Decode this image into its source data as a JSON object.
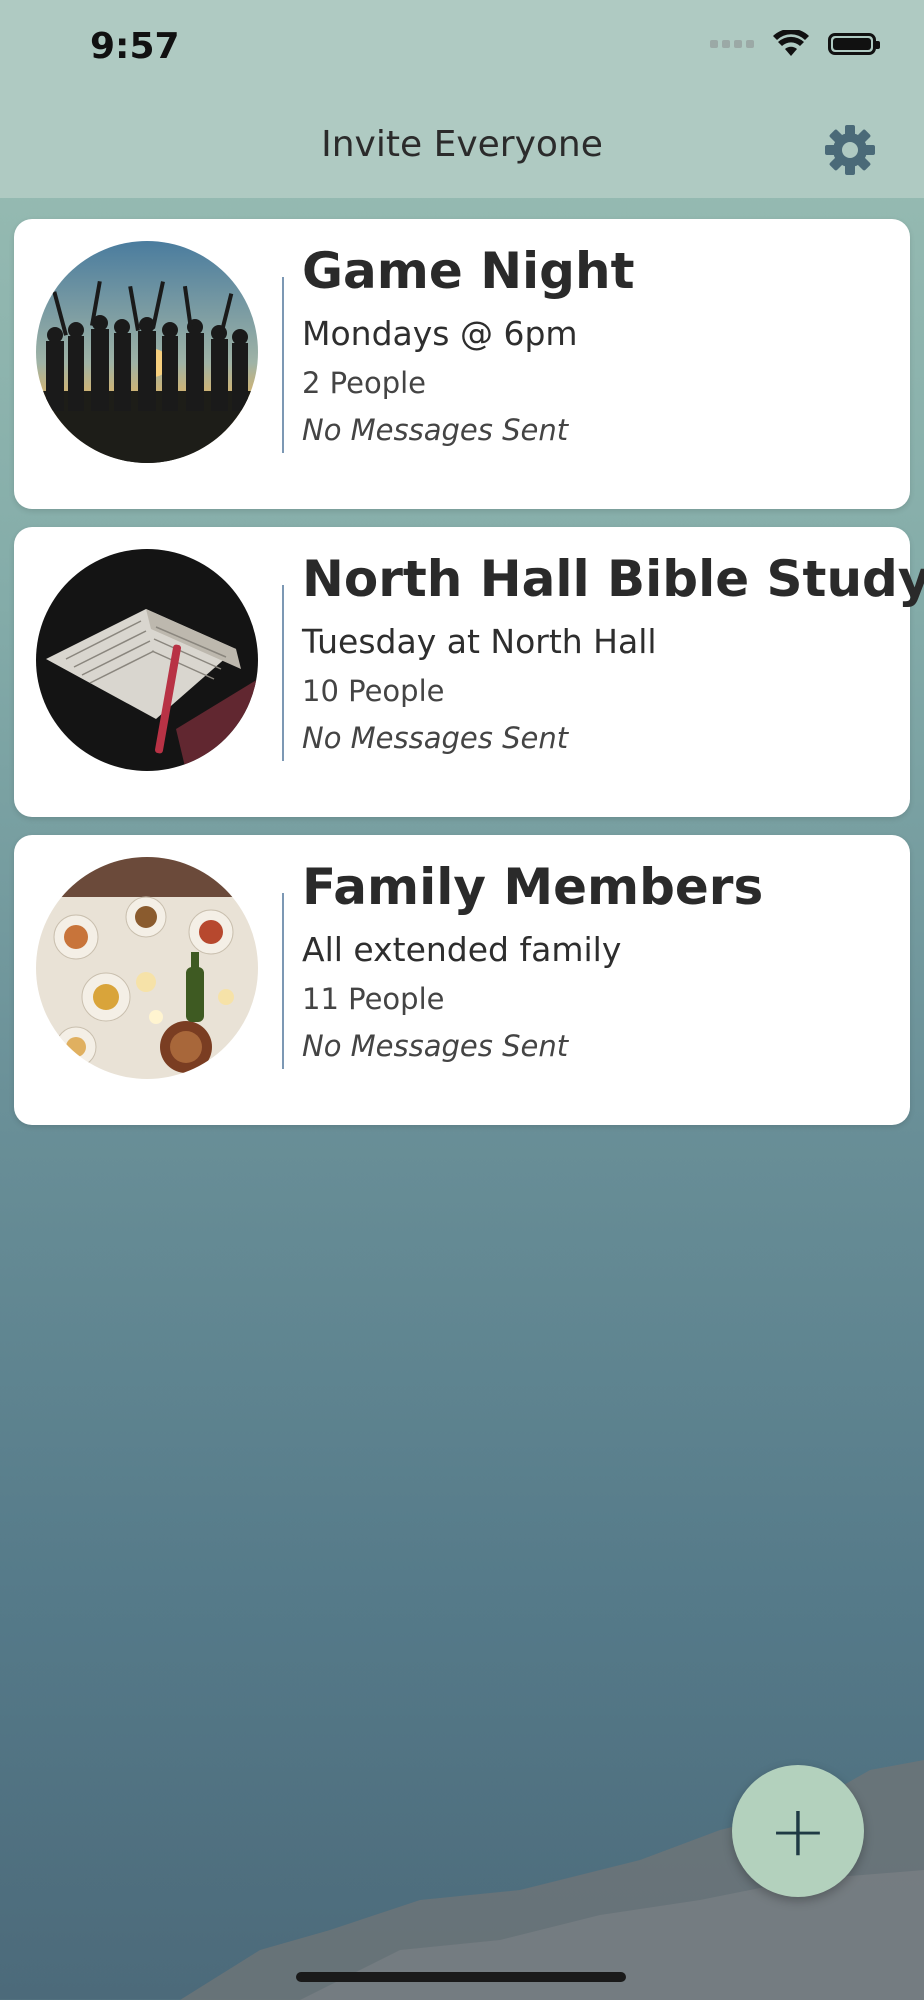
{
  "status_bar": {
    "time": "9:57"
  },
  "header": {
    "title": "Invite Everyone"
  },
  "groups": [
    {
      "name": "Game Night",
      "subtitle": "Mondays @ 6pm",
      "people": "2 People",
      "messages": "No Messages Sent",
      "image": "sunset-crowd-photo"
    },
    {
      "name": "North Hall Bible Study",
      "subtitle": "Tuesday at North Hall",
      "people": "10 People",
      "messages": "No Messages Sent",
      "image": "open-bible-photo"
    },
    {
      "name": "Family Members",
      "subtitle": "All extended family",
      "people": "11 People",
      "messages": "No Messages Sent",
      "image": "dinner-table-photo"
    }
  ],
  "fab": {
    "label": "+"
  },
  "colors": {
    "header_bg": "#afcac2",
    "fab_bg": "#b3d1bd",
    "divider": "#7c98b4",
    "gear": "#4a6a78"
  }
}
